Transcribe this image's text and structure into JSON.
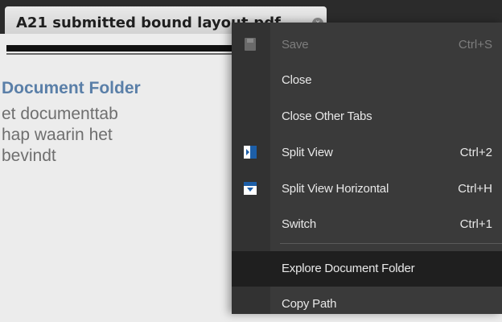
{
  "tab": {
    "title": "A21 submitted bound layout.pdf",
    "close_glyph": "×"
  },
  "tooltip": {
    "title": "Document Folder",
    "lines": [
      "et documenttab",
      "hap waarin het",
      "bevindt"
    ]
  },
  "menu": {
    "items": [
      {
        "label": "Save",
        "shortcut": "Ctrl+S",
        "icon": "save-icon",
        "enabled": false
      },
      {
        "label": "Close",
        "shortcut": "",
        "icon": "",
        "enabled": true
      },
      {
        "label": "Close Other Tabs",
        "shortcut": "",
        "icon": "",
        "enabled": true
      },
      {
        "label": "Split View",
        "shortcut": "Ctrl+2",
        "icon": "split-view-icon",
        "enabled": true
      },
      {
        "label": "Split View Horizontal",
        "shortcut": "Ctrl+H",
        "icon": "split-view-horizontal-icon",
        "enabled": true
      },
      {
        "label": "Switch",
        "shortcut": "Ctrl+1",
        "icon": "",
        "enabled": true
      },
      {
        "label": "Explore Document Folder",
        "shortcut": "",
        "icon": "",
        "enabled": true,
        "highlighted": true
      },
      {
        "label": "Copy Path",
        "shortcut": "",
        "icon": "",
        "enabled": true
      }
    ]
  },
  "colors": {
    "menu_bg": "#3a3a3a",
    "highlight_bg": "#1f1f1f",
    "tooltip_title": "#5a7fa8",
    "tooltip_text": "#6f6f6f"
  }
}
